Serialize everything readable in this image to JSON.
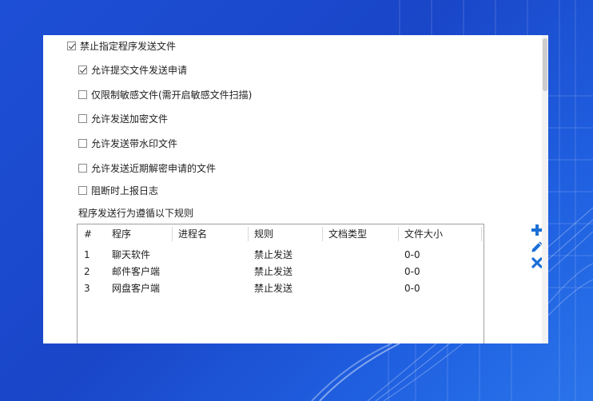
{
  "options": [
    {
      "label": "禁止指定程序发送文件",
      "checked": true
    },
    {
      "label": "允许提交文件发送申请",
      "checked": true
    },
    {
      "label": "仅限制敏感文件(需开启敏感文件扫描)",
      "checked": false
    },
    {
      "label": "允许发送加密文件",
      "checked": false
    },
    {
      "label": "允许发送带水印文件",
      "checked": false
    },
    {
      "label": "允许发送近期解密申请的文件",
      "checked": false
    },
    {
      "label": "阻断时上报日志",
      "checked": false
    }
  ],
  "rules_label": "程序发送行为遵循以下规则",
  "table": {
    "columns": [
      "#",
      "程序",
      "进程名",
      "规则",
      "文档类型",
      "文件大小"
    ],
    "rows": [
      [
        "1",
        "聊天软件",
        "",
        "禁止发送",
        "",
        "0-0"
      ],
      [
        "2",
        "邮件客户端",
        "",
        "禁止发送",
        "",
        "0-0"
      ],
      [
        "3",
        "网盘客户端",
        "",
        "禁止发送",
        "",
        "0-0"
      ]
    ]
  },
  "icons": [
    "plus-icon",
    "pencil-icon",
    "close-icon"
  ],
  "colors": {
    "accent": "#1a6fd6",
    "background": "#1d4fd6"
  }
}
